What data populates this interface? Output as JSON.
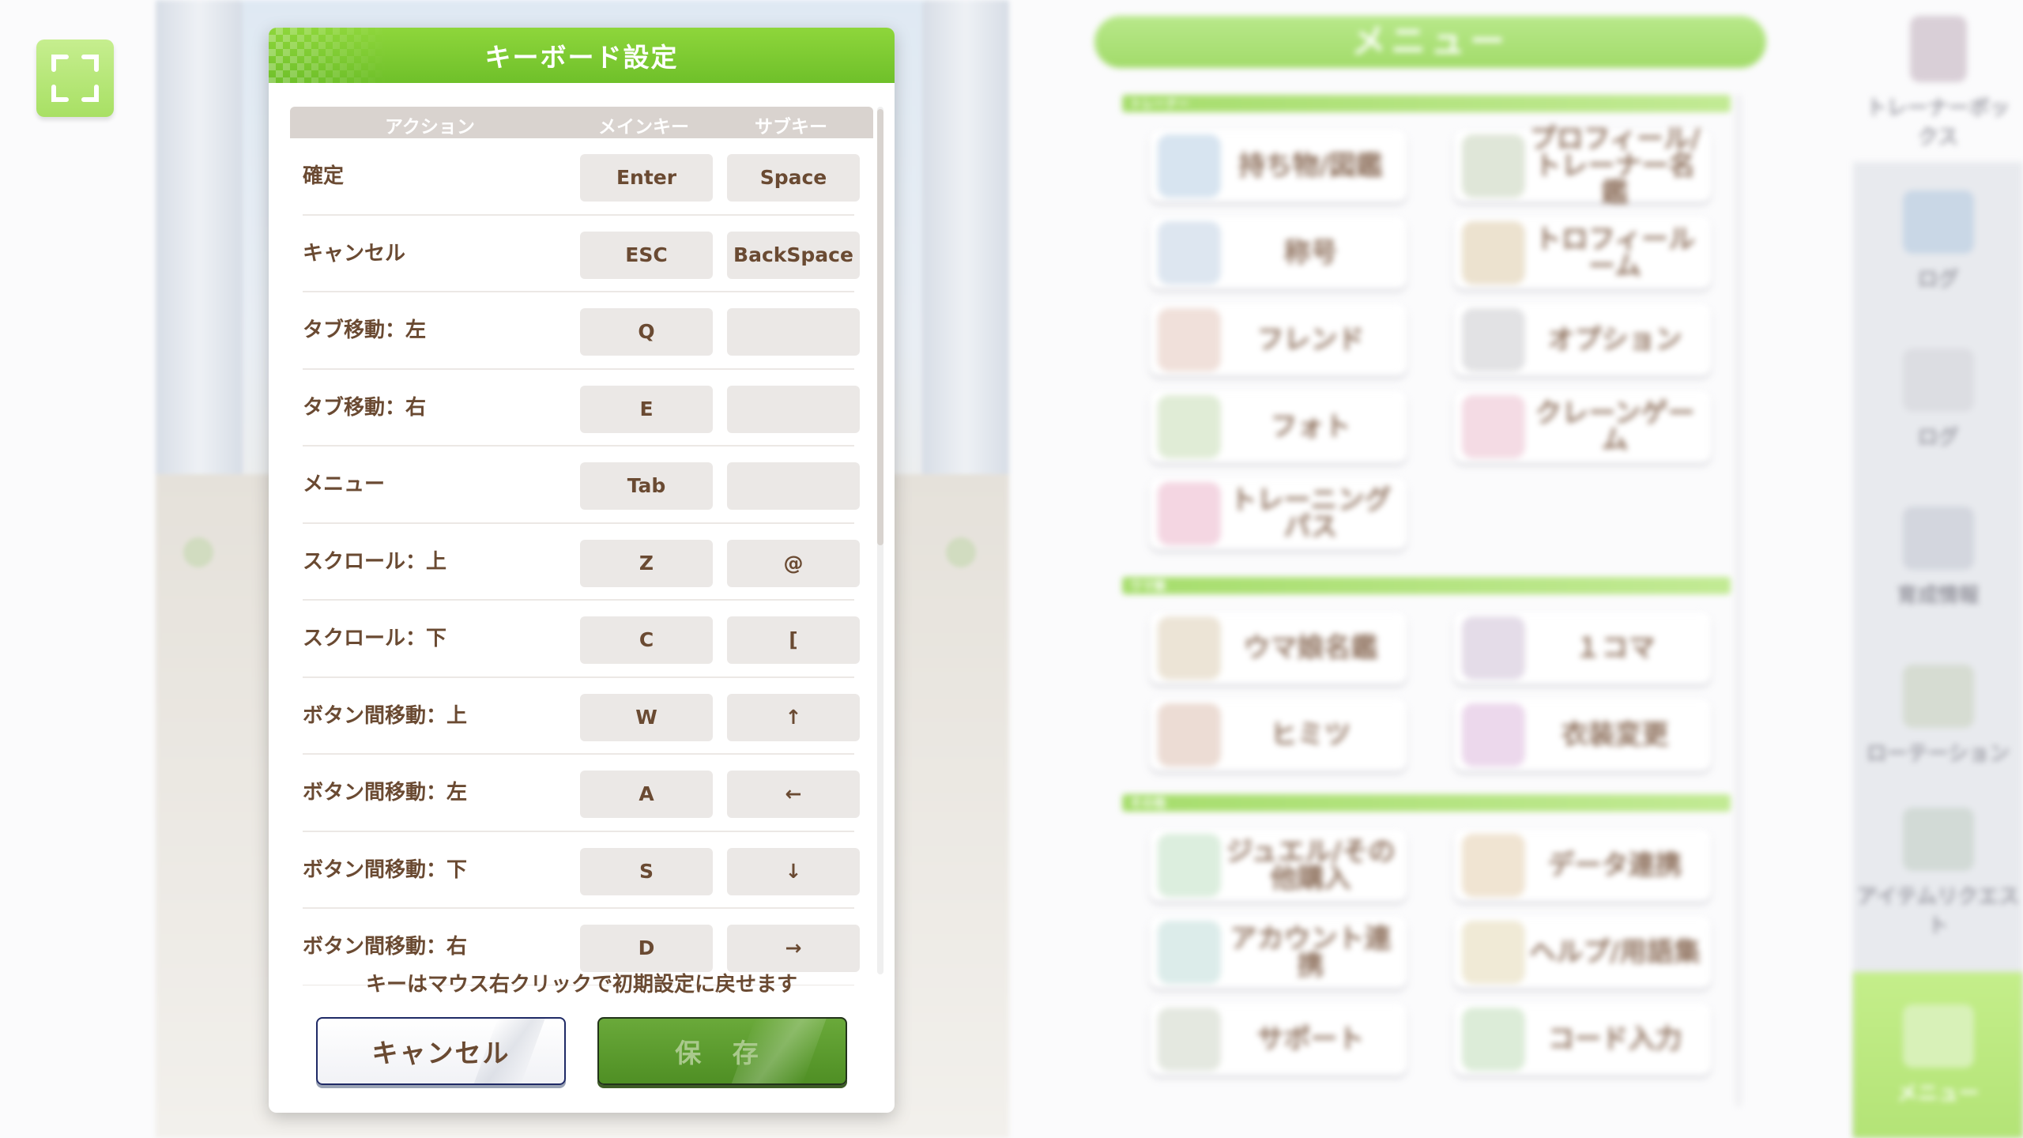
{
  "dialog": {
    "title": "キーボード設定",
    "columns": {
      "action": "アクション",
      "main": "メインキー",
      "sub": "サブキー"
    },
    "rows": [
      {
        "action": "確定",
        "main": "Enter",
        "sub": "Space"
      },
      {
        "action": "キャンセル",
        "main": "ESC",
        "sub": "BackSpace"
      },
      {
        "action": "タブ移動：左",
        "main": "Q",
        "sub": ""
      },
      {
        "action": "タブ移動：右",
        "main": "E",
        "sub": ""
      },
      {
        "action": "メニュー",
        "main": "Tab",
        "sub": ""
      },
      {
        "action": "スクロール：上",
        "main": "Z",
        "sub": "@"
      },
      {
        "action": "スクロール：下",
        "main": "C",
        "sub": "["
      },
      {
        "action": "ボタン間移動：上",
        "main": "W",
        "sub": "↑"
      },
      {
        "action": "ボタン間移動：左",
        "main": "A",
        "sub": "←"
      },
      {
        "action": "ボタン間移動：下",
        "main": "S",
        "sub": "↓"
      },
      {
        "action": "ボタン間移動：右",
        "main": "D",
        "sub": "→"
      }
    ],
    "note": "キーはマウス右クリックで初期設定に戻せます",
    "cancel_label": "キャンセル",
    "save_label": "保 存"
  },
  "menu": {
    "title": "メニュー",
    "sections": [
      {
        "label": "トレーナー",
        "items": [
          "持ち物/図鑑",
          "プロフィール/トレーナー名鑑",
          "称号",
          "トロフィールーム",
          "フレンド",
          "オプション",
          "フォト",
          "クレーンゲーム",
          "トレーニングパス"
        ]
      },
      {
        "label": "ウマ娘",
        "items": [
          "ウマ娘名鑑",
          "１コマ",
          "ヒミツ",
          "衣装変更"
        ]
      },
      {
        "label": "その他",
        "items": [
          "ジュエル/その他購入",
          "データ連携",
          "アカウント連携",
          "ヘルプ/用語集",
          "サポート",
          "コード入力"
        ]
      }
    ]
  },
  "sidebar": {
    "trainer_box": "トレーナーボックス",
    "items": [
      "ログ",
      "ログ",
      "育成情報",
      "ローテーション",
      "アイテムリクエスト",
      "メニュー"
    ]
  },
  "colors": {
    "accent_green": "#7cc832",
    "text_brown": "#6a4a32",
    "save_button": "#5a9a2c"
  },
  "icons": {
    "fullscreen": "fullscreen-icon"
  }
}
